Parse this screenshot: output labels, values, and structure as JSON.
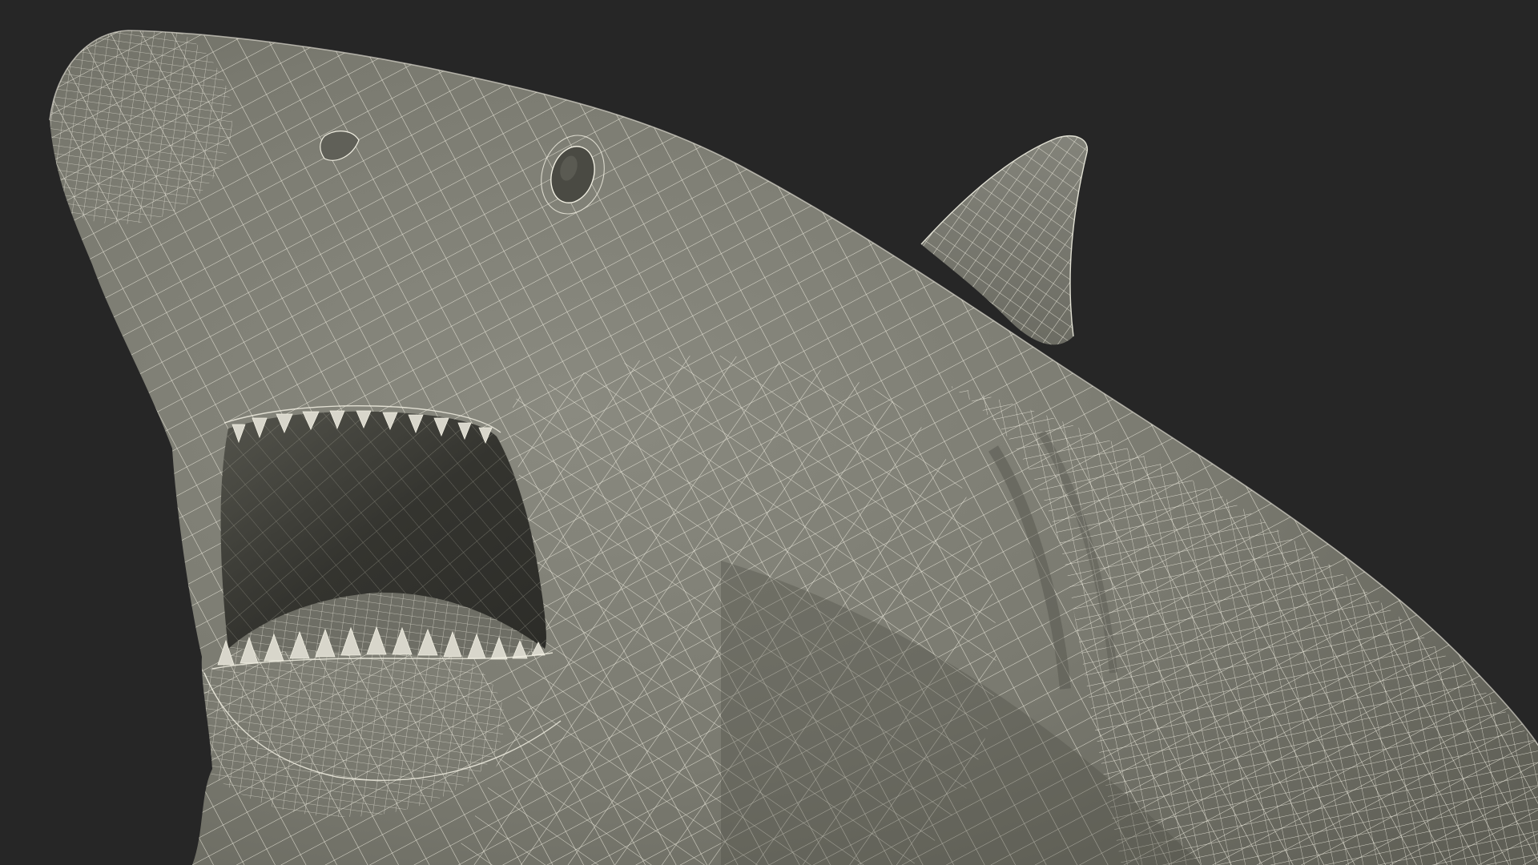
{
  "scene": {
    "subject": "shark-wireframe",
    "colors": {
      "background": "#262626",
      "body": "#7a7a70",
      "body_shade": "#5f5f56",
      "mouth_interior": "#33332e",
      "mouth_deep": "#3d3d37",
      "wire": "#f1efe2",
      "teeth": "#d8d6cb",
      "eye": "#4a4a43"
    }
  }
}
